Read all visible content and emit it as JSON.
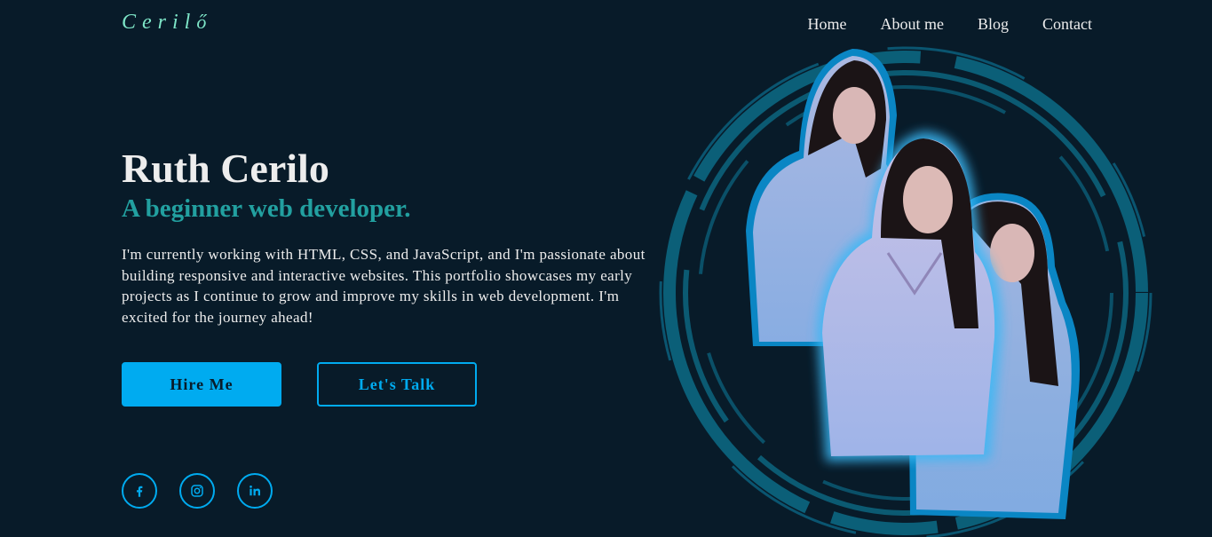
{
  "header": {
    "logo_text": "Ceril",
    "logo_mark": "ő",
    "nav": [
      {
        "label": "Home"
      },
      {
        "label": "About me"
      },
      {
        "label": "Blog"
      },
      {
        "label": "Contact"
      }
    ]
  },
  "hero": {
    "name": "Ruth Cerilo",
    "subtitle": "A beginner web developer.",
    "description": "I'm currently working with HTML, CSS, and JavaScript, and I'm passionate about building responsive and interactive websites. This portfolio showcases my early projects as I continue to grow and improve my skills in web development. I'm excited for the journey ahead!",
    "primary_button": "Hire Me",
    "secondary_button": "Let's Talk"
  },
  "social": [
    {
      "icon": "facebook-icon"
    },
    {
      "icon": "instagram-icon"
    },
    {
      "icon": "linkedin-icon"
    }
  ],
  "colors": {
    "background": "#081b29",
    "accent": "#00abf0",
    "subtitle": "#22a0a0",
    "logo": "#7ee6c8",
    "text": "#ededed"
  }
}
